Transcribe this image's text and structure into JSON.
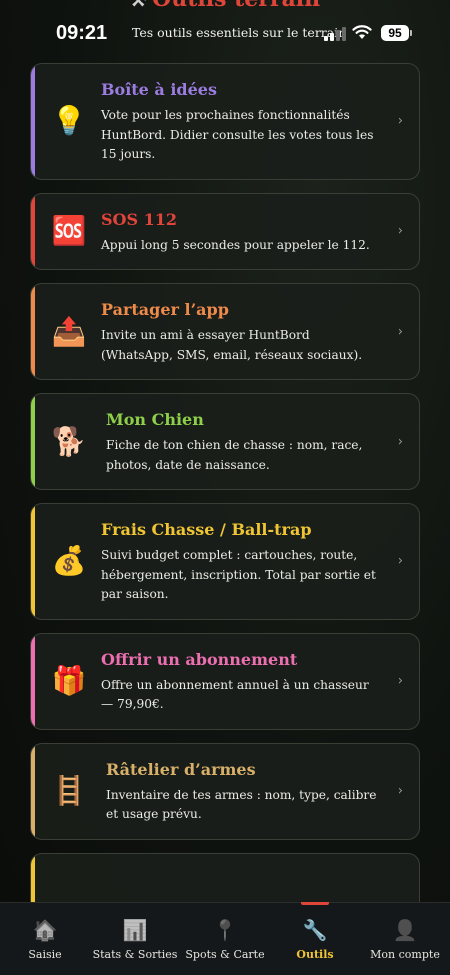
{
  "status_bar": {
    "time": "09:21",
    "subtitle": "Tes outils essentiels sur le terrain",
    "battery": "95"
  },
  "header": {
    "title": "Outils terrain",
    "icon": "tools-icon"
  },
  "cards": [
    {
      "title": "Boîte à idées",
      "desc": "Vote pour les prochaines fonctionnalités HuntBord. Didier consulte les votes tous les 15 jours.",
      "emoji": "💡",
      "icon": "lightbulb-icon",
      "color": "#9b7ce0"
    },
    {
      "title": "SOS 112",
      "desc": "Appui long 5 secondes pour appeler le 112.",
      "emoji": "🆘",
      "icon": "sos-icon",
      "color": "#e2443b"
    },
    {
      "title": "Partager l’app",
      "desc": "Invite un ami à essayer HuntBord (WhatsApp, SMS, email, réseaux sociaux).",
      "emoji": "📤",
      "icon": "share-tray-icon",
      "color": "#ee8a4a"
    },
    {
      "title": "Mon Chien",
      "desc": "Fiche de ton chien de chasse : nom, race, photos, date de naissance.",
      "emoji": "🐕",
      "icon": "dog-icon",
      "color": "#8fd04a"
    },
    {
      "title": "Frais Chasse / Ball-trap",
      "desc": "Suivi budget complet : cartouches, route, hébergement, inscription. Total par sortie et par saison.",
      "emoji": "💰",
      "icon": "money-bag-icon",
      "color": "#f0c534"
    },
    {
      "title": "Offrir un abonnement",
      "desc": "Offre un abonnement annuel à un chasseur — 79,90€.",
      "emoji": "🎁",
      "icon": "gift-icon",
      "color": "#ec6fb0"
    },
    {
      "title": "Râtelier d’armes",
      "desc": "Inventaire de tes armes : nom, type, calibre et usage prévu.",
      "emoji": "🪜",
      "icon": "rack-icon",
      "color": "#d8b06a"
    },
    {
      "title": "",
      "desc": "",
      "emoji": "",
      "icon": "",
      "color": "#f0c534"
    }
  ],
  "nav": [
    {
      "label": "Saisie",
      "icon": "house-icon",
      "glyph": "🏠",
      "active": false
    },
    {
      "label": "Stats & Sorties",
      "icon": "chart-icon",
      "glyph": "📊",
      "active": false
    },
    {
      "label": "Spots & Carte",
      "icon": "pin-icon",
      "glyph": "📍",
      "active": false
    },
    {
      "label": "Outils",
      "icon": "wrench-icon",
      "glyph": "🔧",
      "active": true
    },
    {
      "label": "Mon compte",
      "icon": "user-icon",
      "glyph": "👤",
      "active": false
    }
  ]
}
